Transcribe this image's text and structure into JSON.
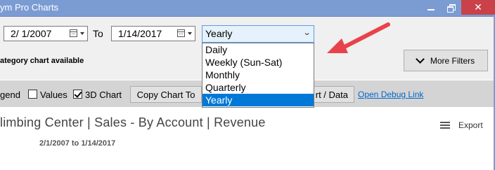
{
  "window": {
    "title": "ym Pro Charts",
    "min_label": "",
    "close_label": "✕"
  },
  "filters": {
    "start_date": "2/ 1/2007",
    "to_label": "To",
    "end_date": "1/14/2017",
    "period_selected": "Yearly",
    "period_options": [
      "Daily",
      "Weekly (Sun-Sat)",
      "Monthly",
      "Quarterly",
      "Yearly"
    ],
    "category_note": "ategory chart available",
    "more_filters_label": "More Filters"
  },
  "options": {
    "legend_label": "gend",
    "values_label": "Values",
    "values_checked": false,
    "chart3d_label": "3D Chart",
    "chart3d_checked": true,
    "copy_chart_label": "Copy Chart To",
    "chart_data_label": "rt / Data",
    "debug_link": "Open Debug Link"
  },
  "chart": {
    "title": "limbing Center | Sales - By Account | Revenue",
    "export_label": "Export",
    "date_range": "2/1/2007 to 1/14/2017"
  },
  "colors": {
    "titlebar": "#7b9cd3",
    "close": "#c9424a",
    "selection": "#0078d7",
    "arrow": "#e8434a",
    "link": "#0066cc"
  },
  "icons": {
    "calendar": "calendar-icon",
    "dropdown": "chevron-down-icon",
    "export": "hamburger-menu-icon",
    "annotation": "red-arrow"
  }
}
